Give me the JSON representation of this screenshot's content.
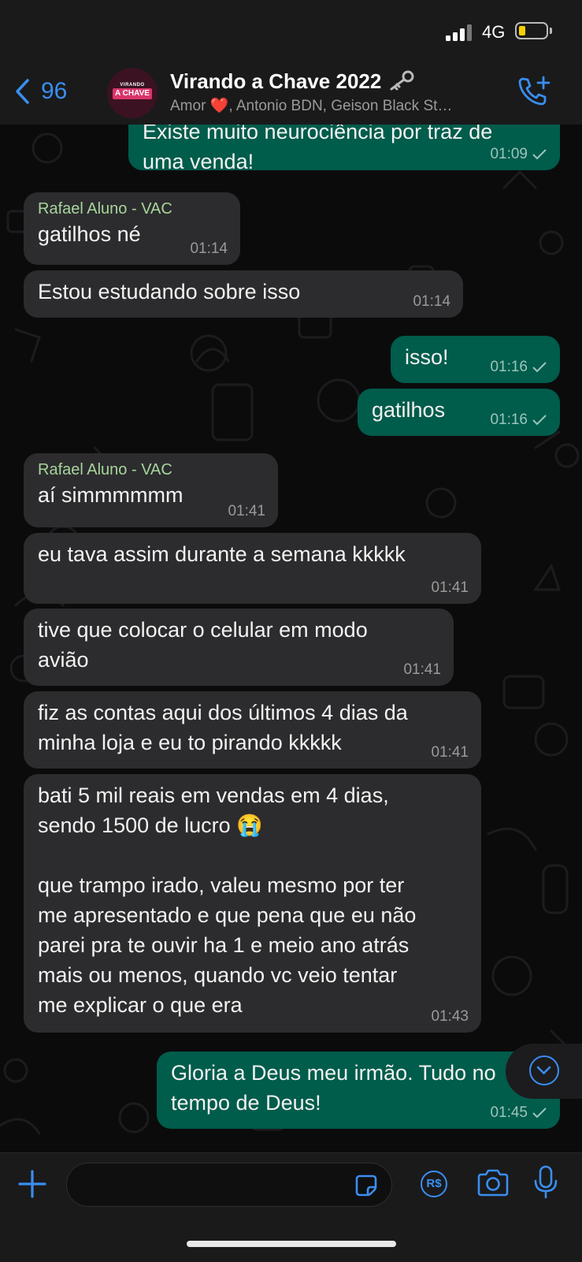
{
  "status_bar": {
    "network": "4G",
    "battery_level": 0.2
  },
  "header": {
    "back_count": "96",
    "title": "Virando a Chave 2022",
    "title_emoji": "key",
    "subtitle": "Amor ❤️, Antonio BDN, Geison Black St…",
    "avatar_line1": "VIRANDO",
    "avatar_line2": "A CHAVE"
  },
  "messages": [
    {
      "direction": "out",
      "sender": "",
      "text": "Existe muito neurociência por traz de\numa venda!",
      "time": "01:09",
      "status": "sent"
    },
    {
      "direction": "in",
      "sender": "Rafael Aluno - VAC",
      "text": "gatilhos né",
      "time": "01:14"
    },
    {
      "direction": "in",
      "sender": "",
      "text": "Estou estudando sobre isso",
      "time": "01:14"
    },
    {
      "direction": "out",
      "sender": "",
      "text": "isso!",
      "time": "01:16",
      "status": "sent"
    },
    {
      "direction": "out",
      "sender": "",
      "text": "gatilhos",
      "time": "01:16",
      "status": "sent"
    },
    {
      "direction": "in",
      "sender": "Rafael Aluno - VAC",
      "text": "aí simmmmmm",
      "time": "01:41"
    },
    {
      "direction": "in",
      "sender": "",
      "text": "eu tava assim durante a semana kkkkk",
      "time": "01:41"
    },
    {
      "direction": "in",
      "sender": "",
      "text": "tive que colocar o celular em modo\navião",
      "time": "01:41"
    },
    {
      "direction": "in",
      "sender": "",
      "text": "fiz as contas aqui dos últimos 4 dias da\nminha loja e eu to pirando kkkkk",
      "time": "01:41"
    },
    {
      "direction": "in",
      "sender": "",
      "text": "bati 5 mil reais em vendas em 4 dias,\nsendo 1500 de lucro 😭\n\nque trampo irado, valeu mesmo por ter\nme apresentado e que pena que eu não\nparei pra te ouvir ha 1 e meio ano atrás\nmais ou menos, quando vc veio tentar\nme explicar o que era",
      "time": "01:43"
    },
    {
      "direction": "out",
      "sender": "",
      "text": "Gloria a Deus meu irmão. Tudo no\ntempo de Deus!",
      "time": "01:45",
      "status": "sent"
    }
  ],
  "composer": {
    "placeholder": "",
    "value": "",
    "pay_label": "R$"
  }
}
